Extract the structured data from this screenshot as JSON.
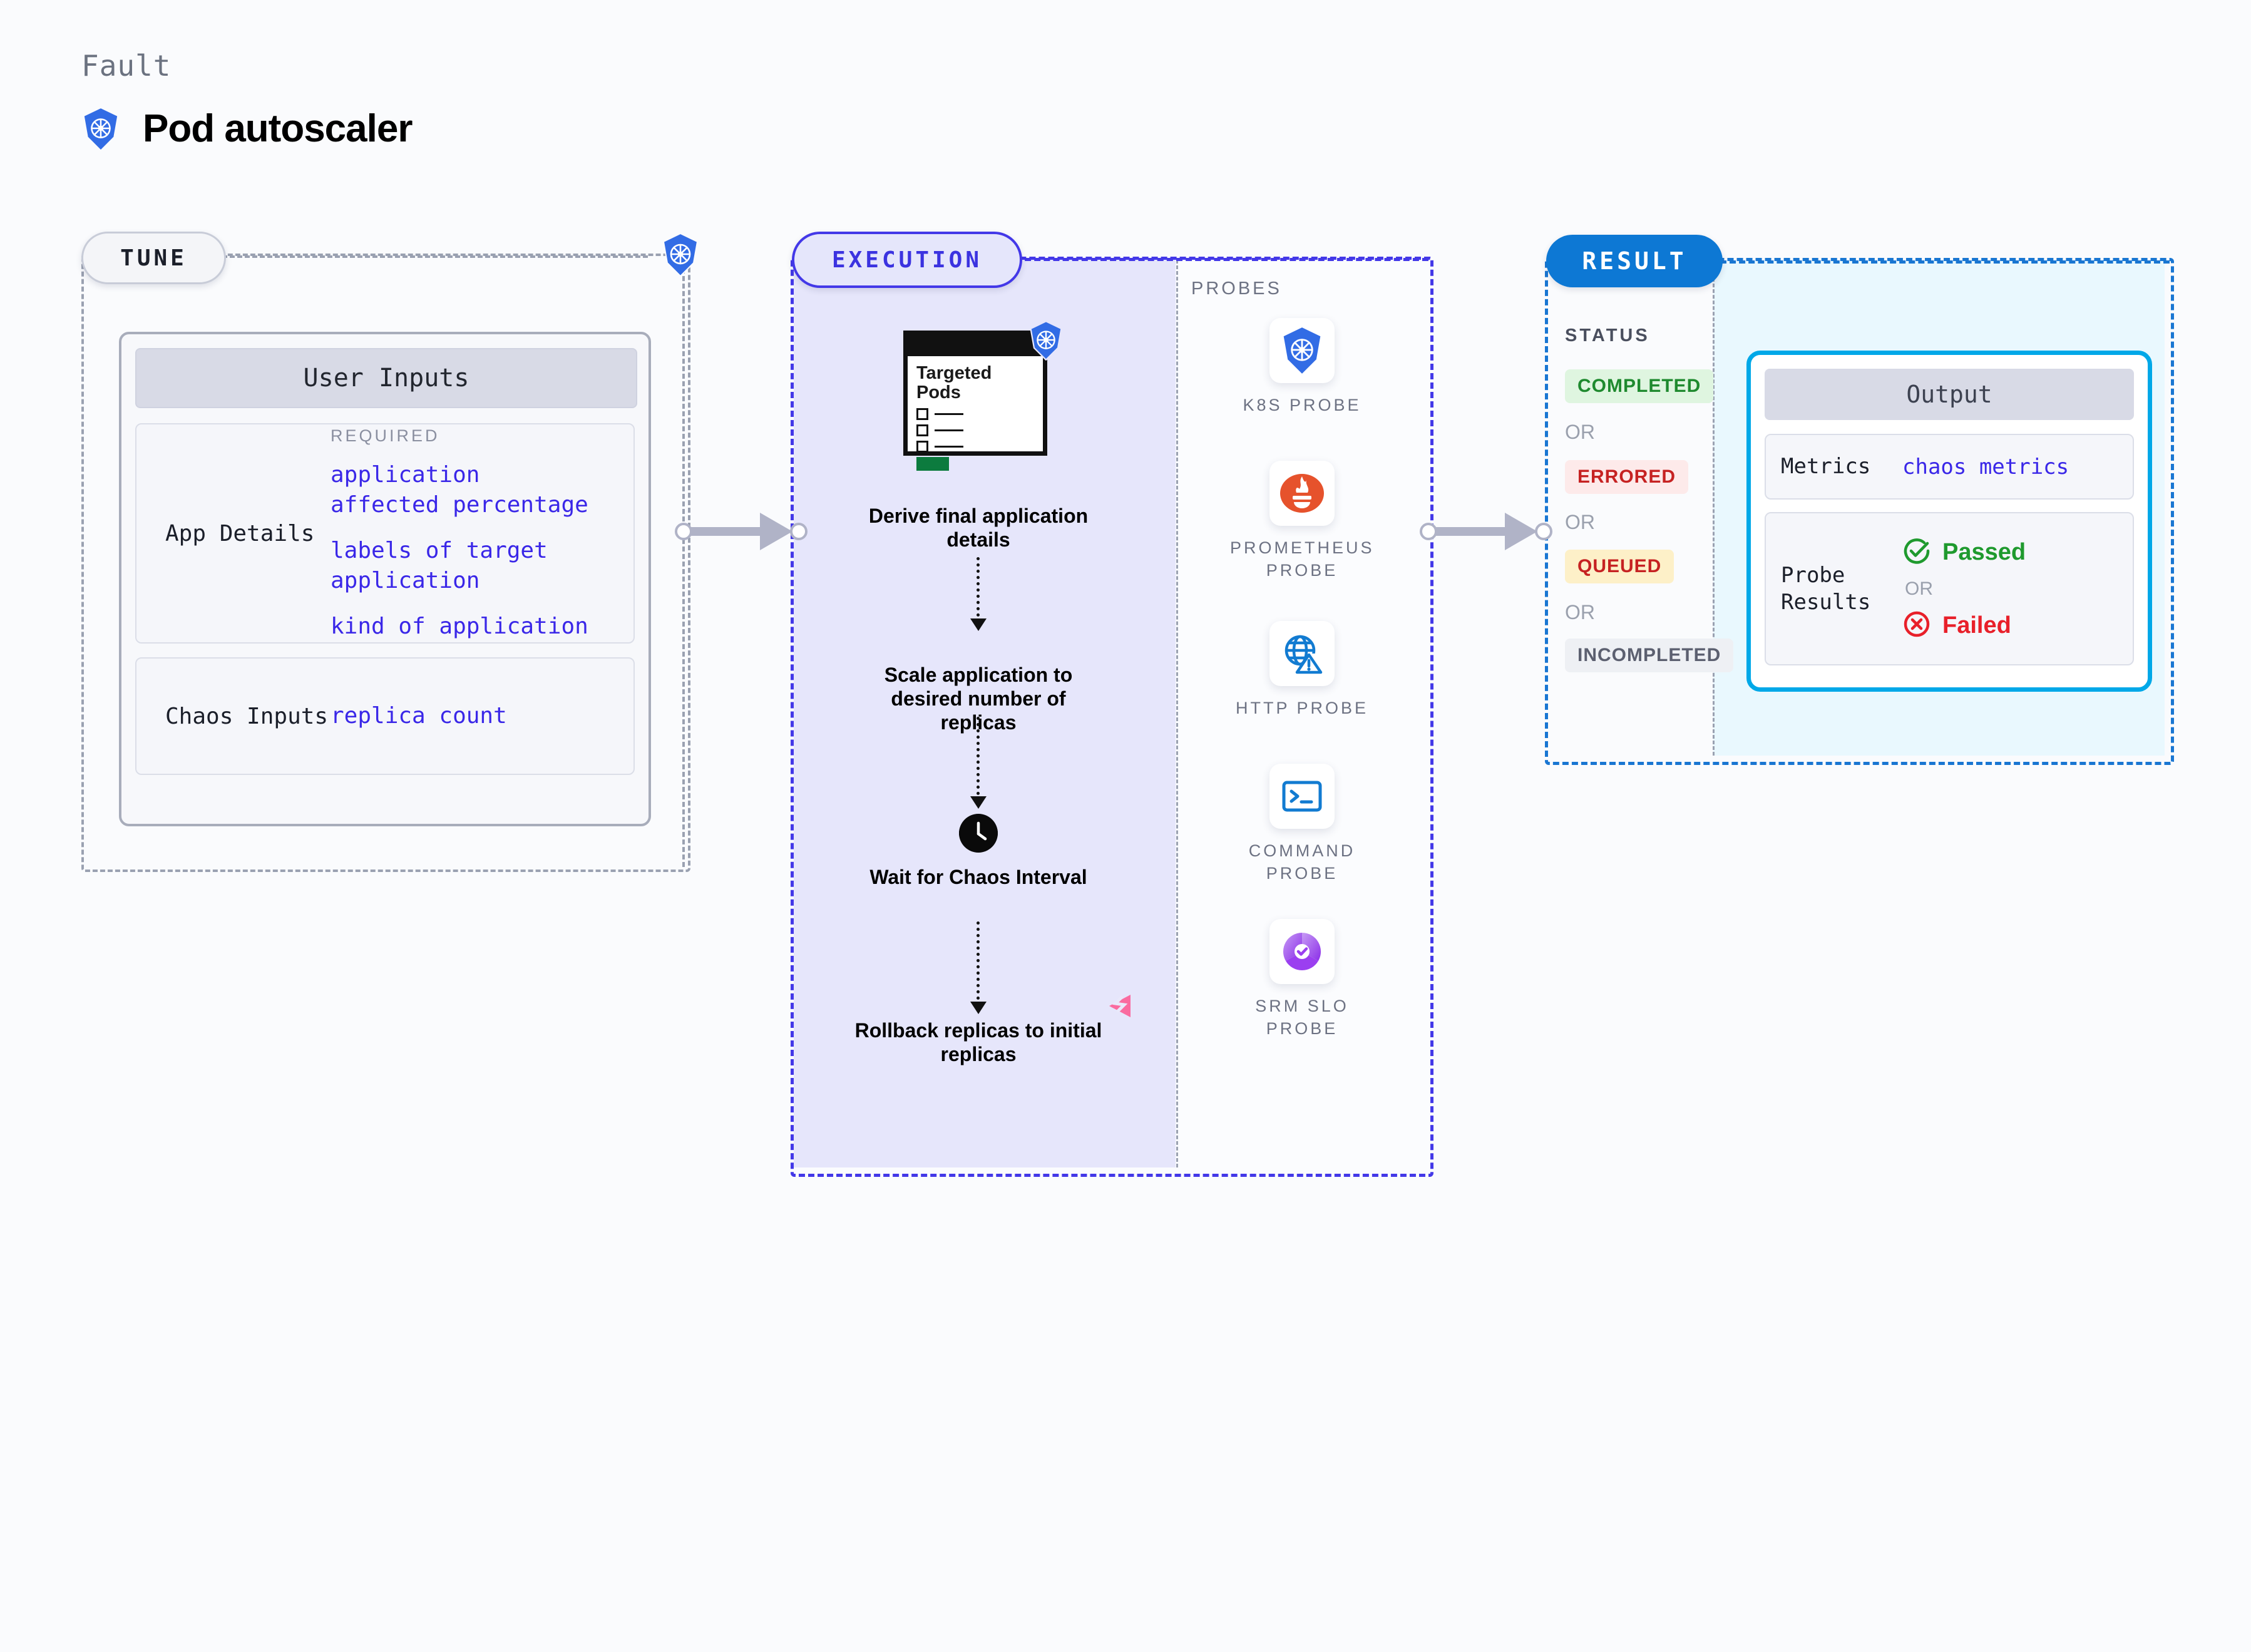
{
  "header": {
    "eyebrow": "Fault",
    "title": "Pod autoscaler",
    "logo_icon": "kubernetes-icon"
  },
  "phases": [
    {
      "id": "tune",
      "label": "TUNE"
    },
    {
      "id": "execution",
      "label": "EXECUTION"
    },
    {
      "id": "result",
      "label": "RESULT"
    }
  ],
  "tune": {
    "badge_icon": "kubernetes-icon",
    "card_title": "User Inputs",
    "rows": [
      {
        "label": "App Details",
        "required_label": "REQUIRED",
        "groups": [
          [
            "application",
            "affected percentage"
          ],
          [
            "labels of target",
            "application"
          ],
          [
            "kind of application"
          ]
        ]
      },
      {
        "label": "Chaos Inputs",
        "groups": [
          [
            "replica count"
          ]
        ]
      }
    ]
  },
  "execution": {
    "pods_card": {
      "title": "Targeted Pods",
      "badge_icon": "kubernetes-icon",
      "checkbox_rows": 3,
      "status_bar_color": "#0c7b3e"
    },
    "steps": [
      {
        "label": "Derive final application details"
      },
      {
        "label": "Scale application to desired number of replicas"
      },
      {
        "label": "Wait for Chaos Interval",
        "icon": "clock-icon"
      },
      {
        "label": "Rollback replicas to initial replicas"
      }
    ],
    "watermark_icon": "litmus-chaos-logo"
  },
  "probes": {
    "section_label": "PROBES",
    "items": [
      {
        "name": "K8S  PROBE",
        "icon": "kubernetes-icon"
      },
      {
        "name": "PROMETHEUS PROBE",
        "icon": "prometheus-icon"
      },
      {
        "name": "HTTP  PROBE",
        "icon": "http-globe-warning-icon"
      },
      {
        "name": "COMMAND PROBE",
        "icon": "terminal-icon"
      },
      {
        "name": "SRM SLO PROBE",
        "icon": "srm-slo-donut-icon"
      }
    ]
  },
  "result": {
    "status_label": "STATUS",
    "or_label": "OR",
    "statuses": [
      {
        "label": "COMPLETED",
        "text_color": "#1f8a2f",
        "bg_color": "#dff5e0"
      },
      {
        "label": "ERRORED",
        "text_color": "#c62222",
        "bg_color": "#fdeaea"
      },
      {
        "label": "QUEUED",
        "text_color": "#c62222",
        "bg_color": "#fdf0c8"
      },
      {
        "label": "INCOMPLETED",
        "text_color": "#5c6070",
        "bg_color": "#eef0f4"
      }
    ],
    "output": {
      "title": "Output",
      "metrics_label": "Metrics",
      "metrics_value": "chaos metrics",
      "probe_results_label": "Probe Results",
      "passed_label": "Passed",
      "failed_label": "Failed",
      "or_label": "OR",
      "passed_color": "#1f9a2e",
      "failed_color": "#e8202a",
      "passed_icon": "check-circle-icon",
      "failed_icon": "x-circle-icon"
    }
  },
  "colors": {
    "canvas_bg": "#fafbfd",
    "tune_border": "#9aa1b1",
    "execution_border": "#4338e8",
    "execution_fill": "#e6e6fb",
    "result_border": "#1976d2",
    "result_fill": "#e9f8fe",
    "mono_accent": "#3a27e8",
    "connector": "#b0b3c7",
    "k8s_blue": "#326ce5"
  }
}
